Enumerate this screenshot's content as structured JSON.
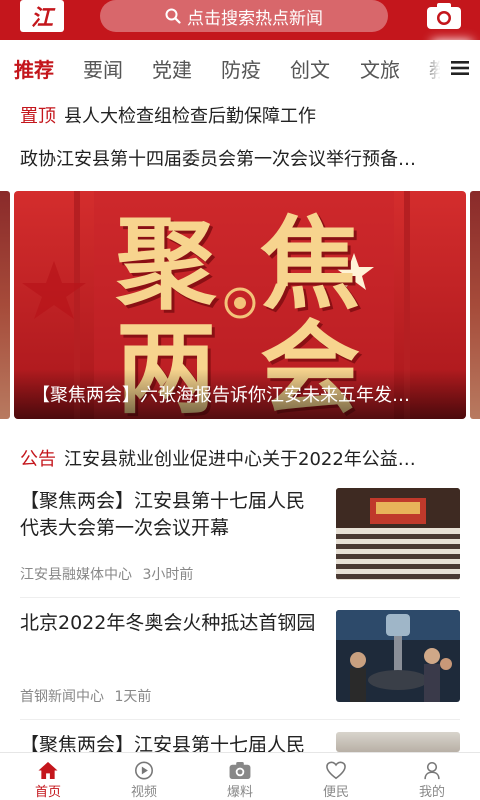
{
  "header": {
    "logo_char": "江",
    "search_placeholder": "点击搜索热点新闻"
  },
  "tabs": [
    "推荐",
    "要闻",
    "党建",
    "防疫",
    "创文",
    "文旅",
    "教"
  ],
  "pinned": {
    "tag": "置顶",
    "text": "县人大检查组检查后勤保障工作"
  },
  "headline2": "政协江安县第十四届委员会第一次会议举行预备…",
  "banner": {
    "graphic_text": [
      "聚",
      "焦",
      "两",
      "会"
    ],
    "caption": "【聚焦两会】六张海报告诉你江安未来五年发…"
  },
  "notice": {
    "tag": "公告",
    "text": "江安县就业创业促进中心关于2022年公益…"
  },
  "news": [
    {
      "title": "【聚焦两会】江安县第十七届人民代表大会第一次会议开幕",
      "source": "江安县融媒体中心",
      "time": "3小时前"
    },
    {
      "title": "北京2022年冬奥会火种抵达首钢园",
      "source": "首钢新闻中心",
      "time": "1天前"
    },
    {
      "title": "【聚焦两会】江安县第十七届人民"
    }
  ],
  "bottom_nav": [
    {
      "label": "首页",
      "icon": "home-icon"
    },
    {
      "label": "视频",
      "icon": "play-icon"
    },
    {
      "label": "爆料",
      "icon": "camera-icon"
    },
    {
      "label": "便民",
      "icon": "heart-icon"
    },
    {
      "label": "我的",
      "icon": "user-icon"
    }
  ],
  "colors": {
    "brand": "#c4161c",
    "muted": "#888888"
  }
}
